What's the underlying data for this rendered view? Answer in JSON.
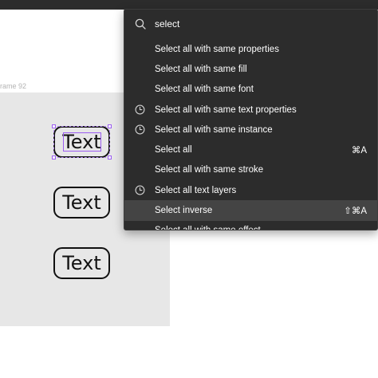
{
  "canvas": {
    "frame_label": "rame 92",
    "buttons": [
      {
        "label": "Text"
      },
      {
        "label": "Text"
      },
      {
        "label": "Text"
      }
    ]
  },
  "palette": {
    "search_value": "select",
    "results": [
      {
        "label": "Select all with same properties",
        "icon": "",
        "shortcut": ""
      },
      {
        "label": "Select all with same fill",
        "icon": "",
        "shortcut": ""
      },
      {
        "label": "Select all with same font",
        "icon": "",
        "shortcut": ""
      },
      {
        "label": "Select all with same text properties",
        "icon": "clock-icon",
        "shortcut": ""
      },
      {
        "label": "Select all with same instance",
        "icon": "clock-icon",
        "shortcut": ""
      },
      {
        "label": "Select all",
        "icon": "",
        "shortcut": "⌘A"
      },
      {
        "label": "Select all with same stroke",
        "icon": "",
        "shortcut": ""
      },
      {
        "label": "Select all text layers",
        "icon": "clock-icon",
        "shortcut": ""
      },
      {
        "label": "Select inverse",
        "icon": "",
        "shortcut": "⇧⌘A"
      },
      {
        "label": "Select all with same effect",
        "icon": "",
        "shortcut": ""
      }
    ]
  },
  "colors": {
    "palette_bg": "#2c2c2c",
    "highlight": "#444444",
    "selection": "#9b5cf0",
    "frame_bg": "#e7e7e7"
  }
}
